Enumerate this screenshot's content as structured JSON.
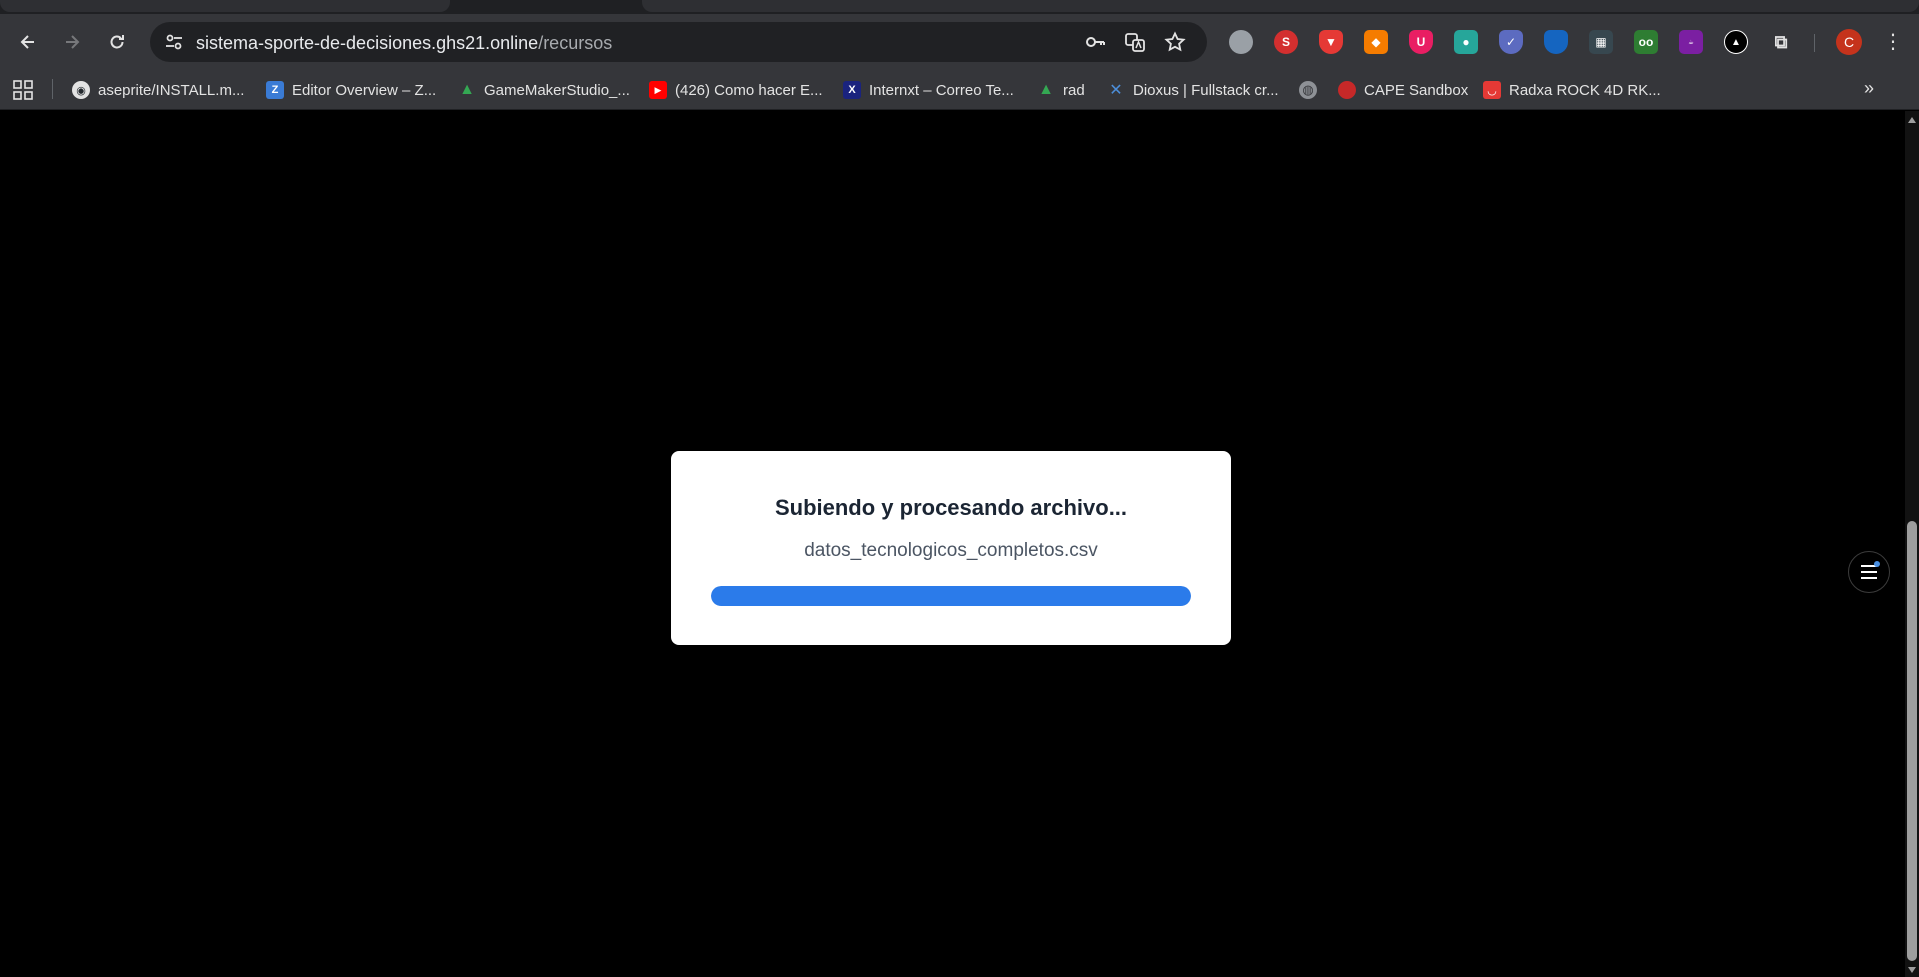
{
  "browser": {
    "url_host": "sistema-sporte-de-decisiones.ghs21.online",
    "url_path": "/recursos",
    "profile_initial": "C",
    "extensions": [
      "cloud-ext-icon",
      "s-ext-icon",
      "brave-shield-icon",
      "fox-wallet-icon",
      "u-ext-icon",
      "grammar-ext-icon",
      "shield-ext-icon",
      "bitwarden-icon",
      "grid-ext-icon",
      "owl-ext-icon",
      "buymeacoffee-icon",
      "triangle-ext-icon",
      "puzzle-extensions-icon"
    ]
  },
  "bookmarks": [
    {
      "label": "aseprite/INSTALL.m...",
      "icon": "github-icon",
      "color": "#24292e"
    },
    {
      "label": "Editor Overview – Z...",
      "icon": "zed-icon",
      "color": "#3a7bd5"
    },
    {
      "label": "GameMakerStudio_...",
      "icon": "google-drive-icon",
      "color": "#1e8e3e"
    },
    {
      "label": "(426) Como hacer E...",
      "icon": "youtube-icon",
      "color": "#ff0000"
    },
    {
      "label": "Internxt – Correo Te...",
      "icon": "internxt-icon",
      "color": "#1a237e"
    },
    {
      "label": "rad",
      "icon": "google-drive-icon",
      "color": "#1e8e3e"
    },
    {
      "label": "Dioxus | Fullstack cr...",
      "icon": "dioxus-icon",
      "color": "#2f6feb"
    },
    {
      "label": "",
      "icon": "globe-icon",
      "color": "#8e9196"
    },
    {
      "label": "CAPE Sandbox",
      "icon": "cape-icon",
      "color": "#c62828"
    },
    {
      "label": "Radxa ROCK 4D RK...",
      "icon": "shop-icon",
      "color": "#e53935"
    }
  ],
  "modal": {
    "title": "Subiendo y procesando archivo...",
    "filename": "datos_tecnologicos_completos.csv",
    "progress": 1.0,
    "accent_color": "#2b7bea"
  }
}
